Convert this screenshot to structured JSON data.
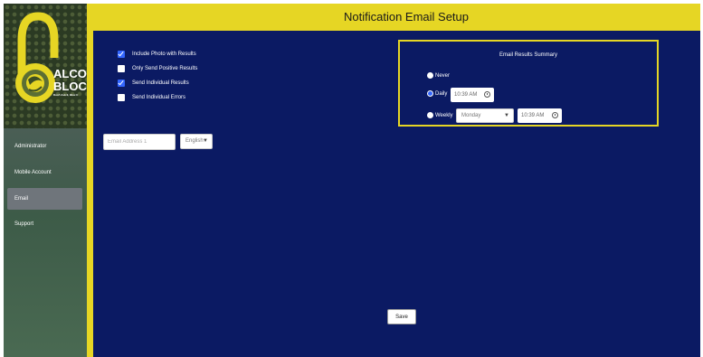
{
  "header": {
    "title": "Notification Email Setup"
  },
  "logo": {
    "line1": "ALCO",
    "line2": "BLOC",
    "tagline": "Don't Ask It, Bloc It"
  },
  "sidebar": {
    "items": [
      {
        "label": "Administrator"
      },
      {
        "label": "Mobile Account"
      },
      {
        "label": "Email",
        "active": true
      },
      {
        "label": "Support"
      }
    ]
  },
  "options": [
    {
      "label": "Include Photo with Results",
      "checked": true
    },
    {
      "label": "Only Send Positive Results",
      "checked": false
    },
    {
      "label": "Send Individual Results",
      "checked": true
    },
    {
      "label": "Send Individual Errors",
      "checked": false
    }
  ],
  "email": {
    "placeholder": "Email Address 1",
    "language": "English"
  },
  "summary": {
    "title": "Email Results Summary",
    "never_label": "Never",
    "daily_label": "Daily",
    "daily_time": "10:39 AM",
    "weekly_label": "Weekly",
    "weekly_day": "Monday",
    "weekly_time": "10:39 AM",
    "selected": "Daily"
  },
  "save_label": "Save",
  "colors": {
    "accent": "#e6d624",
    "background": "#0b1a63",
    "checkbox": "#3366ff"
  }
}
